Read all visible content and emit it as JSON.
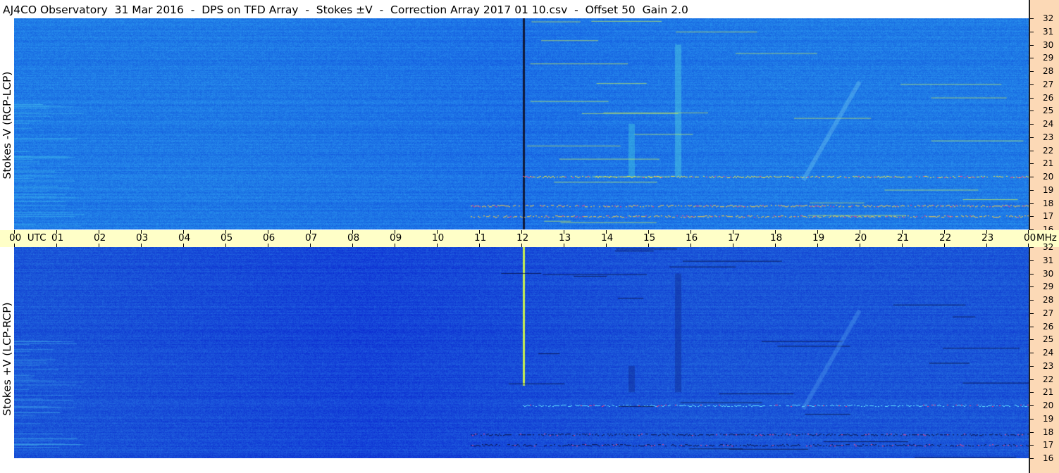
{
  "header": {
    "title": "AJ4CO Observatory  31 Mar 2016  -  DPS on TFD Array  -  Stokes ±V  -  Correction Array 2017 01 10.csv  -  Offset 50  Gain 2.0"
  },
  "time_axis": {
    "first_label": "00  UTC",
    "labels": [
      "01",
      "02",
      "03",
      "04",
      "05",
      "06",
      "07",
      "08",
      "09",
      "10",
      "11",
      "12",
      "13",
      "14",
      "15",
      "16",
      "17",
      "18",
      "19",
      "20",
      "21",
      "22",
      "23"
    ],
    "end_label": "00",
    "freq_unit": "MHz"
  },
  "colors": {
    "background_blue": "#1f7ae6",
    "lower_blue": "#1a55d8",
    "freq_axis_bg": "#fcd9b6",
    "time_axis_bg": "#ffffc8"
  },
  "chart_data": [
    {
      "type": "heatmap",
      "panel": "top",
      "ylabel": "Stokes -V (RCP-LCP)",
      "x_unit": "UTC hour",
      "y_unit": "MHz",
      "xlim": [
        0,
        24
      ],
      "ylim": [
        16,
        32
      ],
      "yticks": [
        "32",
        "31",
        "30",
        "29",
        "28",
        "27",
        "26",
        "25",
        "24",
        "23",
        "22",
        "21",
        "20",
        "19",
        "18",
        "17",
        "16"
      ],
      "features": [
        {
          "kind": "vertical_burst",
          "x": 12.05,
          "y": [
            16,
            32
          ],
          "color": "#101838"
        },
        {
          "kind": "vertical_band",
          "x": 14.6,
          "y": [
            20,
            24
          ],
          "color": "#40c8e0"
        },
        {
          "kind": "vertical_band",
          "x": 15.7,
          "y": [
            20,
            30
          ],
          "color": "#50d0e0"
        },
        {
          "kind": "horizontal_band",
          "x": [
            10.8,
            24
          ],
          "y": 17.8,
          "color": "#ffd040"
        },
        {
          "kind": "horizontal_band",
          "x": [
            10.8,
            24
          ],
          "y": 17.0,
          "color": "#ffd040"
        },
        {
          "kind": "horizontal_band",
          "x": [
            12.0,
            24
          ],
          "y": 20.0,
          "color": "#f0e040"
        }
      ]
    },
    {
      "type": "heatmap",
      "panel": "bottom",
      "ylabel": "Stokes +V (LCP-RCP)",
      "x_unit": "UTC hour",
      "y_unit": "MHz",
      "xlim": [
        0,
        24
      ],
      "ylim": [
        16,
        32
      ],
      "yticks": [
        "32",
        "31",
        "30",
        "29",
        "28",
        "27",
        "26",
        "25",
        "24",
        "23",
        "22",
        "21",
        "20",
        "19",
        "18",
        "17",
        "16"
      ],
      "features": [
        {
          "kind": "vertical_burst",
          "x": 12.05,
          "y": [
            21.5,
            32
          ],
          "color": "#c8f050"
        },
        {
          "kind": "vertical_band",
          "x": 14.6,
          "y": [
            21,
            23
          ],
          "color": "#102a90"
        },
        {
          "kind": "vertical_band",
          "x": 15.7,
          "y": [
            21,
            30
          ],
          "color": "#102a90"
        },
        {
          "kind": "horizontal_band",
          "x": [
            10.8,
            24
          ],
          "y": 17.8,
          "color": "#0a0f40"
        },
        {
          "kind": "horizontal_band",
          "x": [
            10.8,
            24
          ],
          "y": 17.0,
          "color": "#0a0f40"
        },
        {
          "kind": "horizontal_band",
          "x": [
            12.0,
            24
          ],
          "y": 20.0,
          "color": "#60e0ff"
        }
      ]
    }
  ]
}
